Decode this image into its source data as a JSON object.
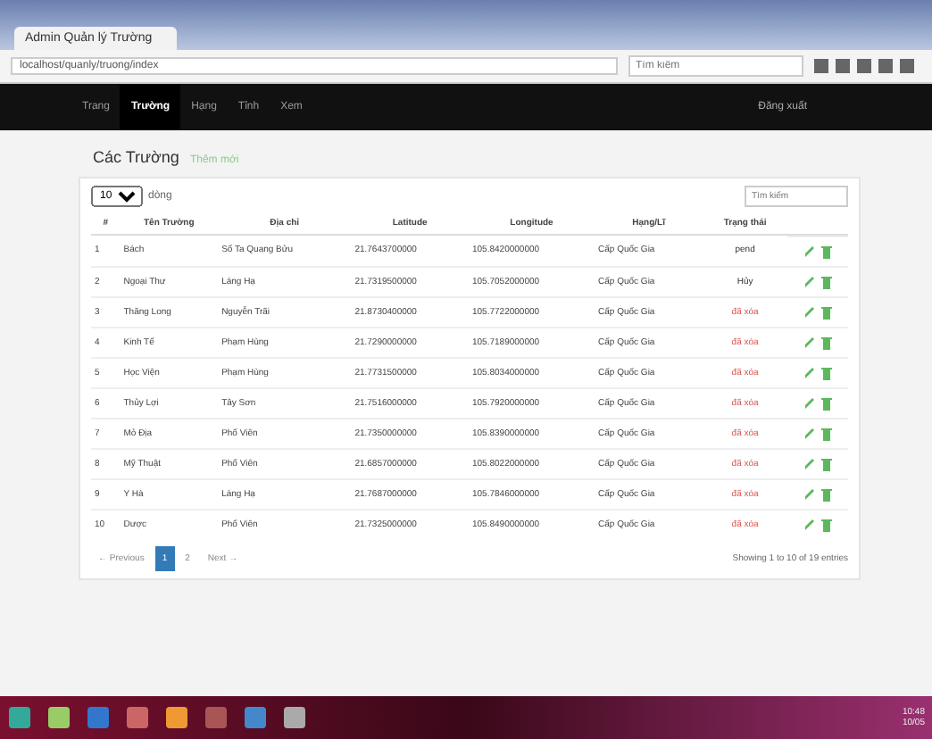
{
  "browser": {
    "tab_title": "Admin Quản lý Trường",
    "url": "localhost/quanly/truong/index",
    "search_placeholder": "Tìm kiếm"
  },
  "navbar": {
    "items": [
      {
        "label": "Trang",
        "selected": false
      },
      {
        "label": "Trường",
        "selected": true
      },
      {
        "label": "Hạng",
        "selected": false
      },
      {
        "label": "Tỉnh",
        "selected": false
      },
      {
        "label": "Xem",
        "selected": false
      }
    ],
    "user": "Đăng xuất"
  },
  "page": {
    "title": "Các Trường",
    "subtitle": "Thêm mới"
  },
  "length_select": {
    "value": "10",
    "label": "dòng"
  },
  "search": {
    "placeholder": "Tìm kiếm"
  },
  "table": {
    "columns": [
      "#",
      "Tên Trường",
      "Địa chỉ",
      "Latitude",
      "Longitude",
      "Hạng/Lĩ",
      "Trạng thái"
    ],
    "rows": [
      {
        "cells": [
          "1",
          "Bách",
          "Số Ta Quang Bửu",
          "21.7643700000",
          "105.8420000000",
          "Cấp Quốc Gia",
          "pend"
        ],
        "kind": "normal"
      },
      {
        "cells": [
          "2",
          "Ngoại Thư",
          "Láng Hạ",
          "21.7319500000",
          "105.7052000000",
          "Cấp Quốc Gia",
          "Hủy"
        ],
        "kind": "normal"
      },
      {
        "cells": [
          "3",
          "Thăng Long",
          "Nguyễn Trãi",
          "21.8730400000",
          "105.7722000000",
          "Cấp Quốc Gia",
          "đã xóa"
        ],
        "kind": "alert"
      },
      {
        "cells": [
          "4",
          "Kinh Tế",
          "Phạm Hùng",
          "21.7290000000",
          "105.7189000000",
          "Cấp Quốc Gia",
          "đã xóa"
        ],
        "kind": "alert"
      },
      {
        "cells": [
          "5",
          "Học Viện",
          "Phạm Hùng",
          "21.7731500000",
          "105.8034000000",
          "Cấp Quốc Gia",
          "đã xóa"
        ],
        "kind": "alert"
      },
      {
        "cells": [
          "6",
          "Thủy Lợi",
          "Tây Sơn",
          "21.7516000000",
          "105.7920000000",
          "Cấp Quốc Gia",
          "đã xóa"
        ],
        "kind": "alert"
      },
      {
        "cells": [
          "7",
          "Mỏ Địa",
          "Phố Viên",
          "21.7350000000",
          "105.8390000000",
          "Cấp Quốc Gia",
          "đã xóa"
        ],
        "kind": "alert"
      },
      {
        "cells": [
          "8",
          "Mỹ Thuật",
          "Phố Viên",
          "21.6857000000",
          "105.8022000000",
          "Cấp Quốc Gia",
          "đã xóa"
        ],
        "kind": "alert"
      },
      {
        "cells": [
          "9",
          "Y Hà",
          "Láng Hạ",
          "21.7687000000",
          "105.7846000000",
          "Cấp Quốc Gia",
          "đã xóa"
        ],
        "kind": "alert"
      },
      {
        "cells": [
          "10",
          "Dược",
          "Phố Viên",
          "21.7325000000",
          "105.8490000000",
          "Cấp Quốc Gia",
          "đã xóa"
        ],
        "kind": "alert"
      }
    ]
  },
  "pagination": {
    "previous": "← Previous",
    "pages": [
      {
        "label": "1",
        "selected": true
      },
      {
        "label": "2",
        "selected": false
      }
    ],
    "next": "Next →"
  },
  "info": "Showing 1 to 10 of 19 entries",
  "taskbar": {
    "time": "10:48",
    "date": "10/05"
  }
}
